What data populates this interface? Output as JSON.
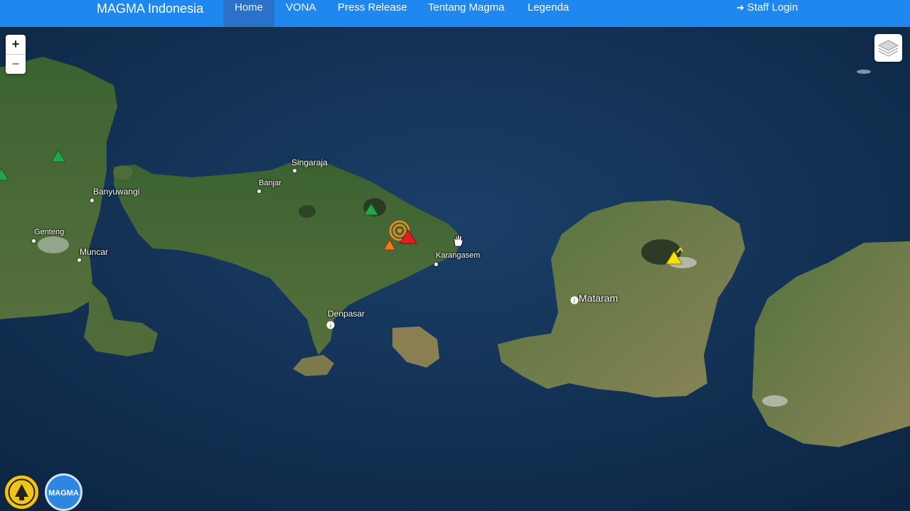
{
  "navbar": {
    "brand": "MAGMA Indonesia",
    "items": [
      {
        "label": "Home",
        "active": true
      },
      {
        "label": "VONA",
        "active": false
      },
      {
        "label": "Press Release",
        "active": false
      },
      {
        "label": "Tentang Magma",
        "active": false
      },
      {
        "label": "Legenda",
        "active": false
      }
    ],
    "login_label": "Staff Login",
    "login_icon": "sign-in-icon",
    "color": "#1e88f0"
  },
  "map": {
    "zoom_in": "+",
    "zoom_out": "−",
    "layers_icon": "layers-icon",
    "places": {
      "singaraja": "Singaraja",
      "banjar": "Banjar",
      "banyuwangi": "Banyuwangi",
      "genteng": "Genteng",
      "muncar": "Muncar",
      "karangasem": "Karangasem",
      "denpasar": "Denpasar",
      "mataram": "Mataram"
    },
    "volcano_status_colors": {
      "normal": "#22a84a",
      "waspada": "#f5e20a",
      "siaga": "#f07a1a",
      "awas": "#e02020"
    }
  },
  "logos": {
    "esdm": "esdm-logo",
    "magma": "MAGMA"
  }
}
